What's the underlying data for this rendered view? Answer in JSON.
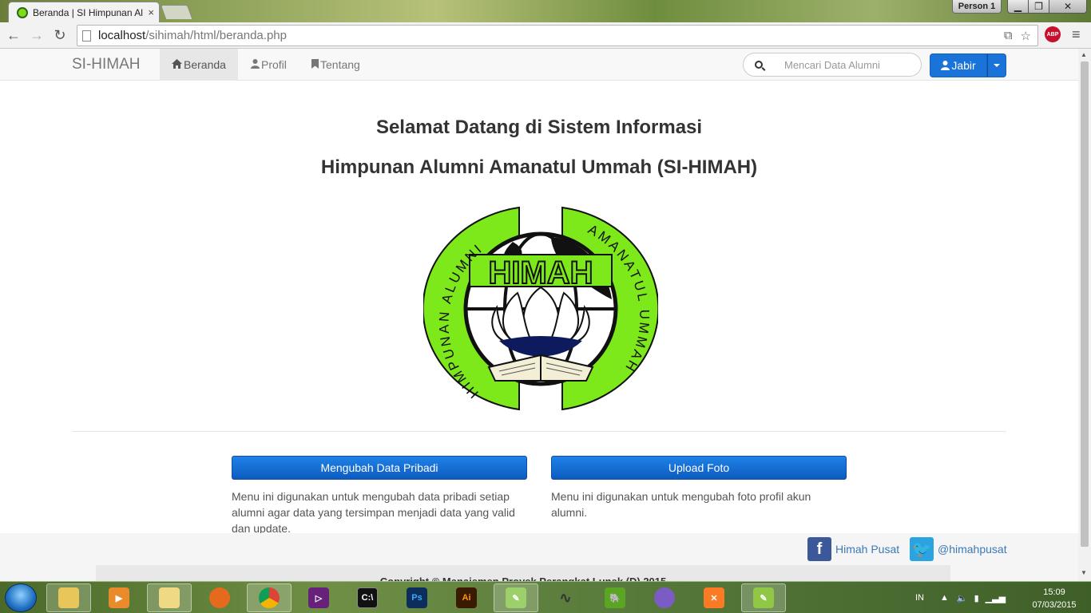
{
  "browser": {
    "tab_title": "Beranda | SI Himpunan Al",
    "tab_close": "×",
    "profile": "Person 1",
    "url_host": "localhost",
    "url_path": "/sihimah/html/beranda.php",
    "abp_label": "ABP"
  },
  "site": {
    "brand": "SI-HIMAH",
    "nav": [
      {
        "label": "Beranda",
        "icon": "home-icon",
        "active": true
      },
      {
        "label": "Profil",
        "icon": "user-icon",
        "active": false
      },
      {
        "label": "Tentang",
        "icon": "bookmark-icon",
        "active": false
      }
    ],
    "search_placeholder": "Mencari Data Alumni",
    "user_label": "Jabir"
  },
  "main": {
    "headline_1": "Selamat Datang di Sistem Informasi",
    "headline_2": "Himpunan Alumni Amanatul Ummah (SI-HIMAH)",
    "logo": {
      "top_text": "HIMAH",
      "left_ring_text": "HIMPUNAN ALUMNI",
      "right_ring_text": "AMANATUL UMMAH",
      "ring_color": "#7de81a"
    },
    "actions": [
      {
        "label": "Mengubah Data Pribadi",
        "desc": "Menu ini digunakan untuk mengubah data pribadi setiap alumni agar data yang tersimpan menjadi data yang valid dan update."
      },
      {
        "label": "Upload Foto",
        "desc": "Menu ini digunakan untuk mengubah foto profil akun alumni."
      }
    ]
  },
  "footer": {
    "facebook": "Himah Pusat",
    "twitter": "@himahpusat",
    "copyright": "Copyright © Manajemen Proyek Perangkat Lunak (D) 2015"
  },
  "taskbar": {
    "language": "IN",
    "time": "15:09",
    "date": "07/03/2015",
    "apps": [
      "explorer",
      "media-player",
      "windows-explorer",
      "firefox",
      "chrome",
      "visual-studio",
      "cmd",
      "photoshop",
      "illustrator",
      "bluefish",
      "app-unknown",
      "evernote",
      "github",
      "xampp",
      "notepad-plus-plus"
    ]
  },
  "colors": {
    "primary_button": "#1a73d8",
    "logo_green": "#7de81a",
    "link": "#3a79b7"
  }
}
